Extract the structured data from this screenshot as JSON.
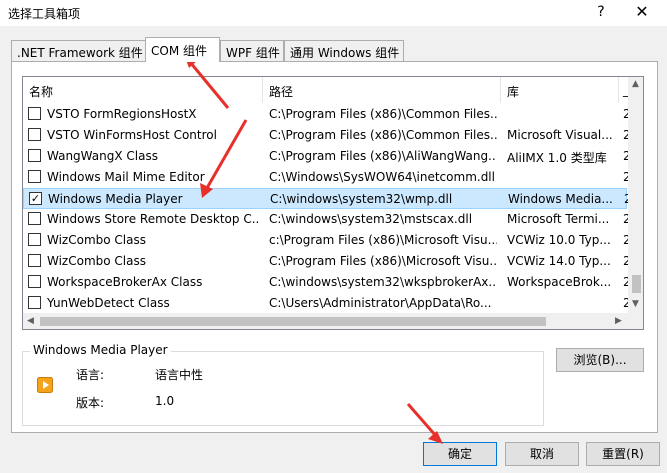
{
  "window": {
    "title": "选择工具箱项",
    "help": "?",
    "close": "✕"
  },
  "tabs": [
    {
      "label": ".NET Framework 组件"
    },
    {
      "label": "COM 组件"
    },
    {
      "label": "WPF 组件"
    },
    {
      "label": "通用 Windows 组件"
    }
  ],
  "table": {
    "columns": [
      "名称",
      "路径",
      "库"
    ],
    "rows": [
      {
        "checked": false,
        "name": "VSTO FormRegionsHostX",
        "path": "C:\\Program Files (x86)\\Common Files...",
        "library": ""
      },
      {
        "checked": false,
        "name": "VSTO WinFormsHost Control",
        "path": "C:\\Program Files (x86)\\Common Files...",
        "library": "Microsoft Visual..."
      },
      {
        "checked": false,
        "name": "WangWangX Class",
        "path": "C:\\Program Files (x86)\\AliWangWang...",
        "library": "AliIMX 1.0 类型库"
      },
      {
        "checked": false,
        "name": "Windows Mail Mime Editor",
        "path": "C:\\Windows\\SysWOW64\\inetcomm.dll",
        "library": ""
      },
      {
        "checked": true,
        "name": "Windows Media Player",
        "path": "C:\\windows\\system32\\wmp.dll",
        "library": "Windows Media..."
      },
      {
        "checked": false,
        "name": "Windows Store Remote Desktop C...",
        "path": "C:\\windows\\system32\\mstscax.dll",
        "library": "Microsoft Termi..."
      },
      {
        "checked": false,
        "name": "WizCombo Class",
        "path": "c:\\Program Files (x86)\\Microsoft Visu...",
        "library": "VCWiz 10.0 Typ..."
      },
      {
        "checked": false,
        "name": "WizCombo Class",
        "path": "C:\\Program Files (x86)\\Microsoft Visu...",
        "library": "VCWiz 14.0 Typ..."
      },
      {
        "checked": false,
        "name": "WorkspaceBrokerAx Class",
        "path": "C:\\windows\\system32\\wkspbrokerAx....",
        "library": "WorkspaceBrok..."
      },
      {
        "checked": false,
        "name": "YunWebDetect Class",
        "path": "C:\\Users\\Administrator\\AppData\\Ro...",
        "library": ""
      }
    ],
    "extra_column_marks": [
      "_",
      "2",
      "2",
      "2",
      "2",
      "2",
      "2",
      "2",
      "2",
      "2"
    ]
  },
  "details": {
    "group_title": "Windows Media Player",
    "language_label": "语言:",
    "language_value": "语言中性",
    "version_label": "版本:",
    "version_value": "1.0"
  },
  "buttons": {
    "browse": "浏览(B)...",
    "ok": "确定",
    "cancel": "取消",
    "reset": "重置(R)"
  },
  "colors": {
    "selection": "#cce8ff",
    "annotation_arrow": "#e8302a",
    "icon_orange": "#f5a31a"
  }
}
